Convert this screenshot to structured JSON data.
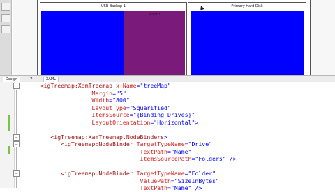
{
  "designer": {
    "treemap_panels": [
      {
        "title": "USB Backup 1",
        "tiles": [
          {
            "label": "",
            "color": "#0000ff"
          },
          {
            "label": "Sprint 1",
            "color": "#7a1a7a"
          }
        ]
      },
      {
        "title": "Primary Hard Disk",
        "tiles": [
          {
            "label": "",
            "color": "#0000ff"
          }
        ]
      }
    ]
  },
  "tabs": {
    "design": "Design",
    "swap": "⇅",
    "xaml": "XAML"
  },
  "editor": {
    "lines": [
      {
        "indent": 6,
        "parts": [
          [
            "tag",
            "<igTreemap:XamTreemap "
          ],
          [
            "attr",
            "x:Name"
          ],
          [
            "pun",
            "=\""
          ],
          [
            "val",
            "treeMap"
          ],
          [
            "pun",
            "\""
          ]
        ]
      },
      {
        "indent": 21,
        "parts": [
          [
            "attr",
            "Margin"
          ],
          [
            "pun",
            "=\""
          ],
          [
            "val",
            "5"
          ],
          [
            "pun",
            "\""
          ]
        ]
      },
      {
        "indent": 21,
        "parts": [
          [
            "attr",
            "Width"
          ],
          [
            "pun",
            "=\""
          ],
          [
            "val",
            "800"
          ],
          [
            "pun",
            "\""
          ]
        ]
      },
      {
        "indent": 21,
        "parts": [
          [
            "attr",
            "LayoutType"
          ],
          [
            "pun",
            "=\""
          ],
          [
            "val",
            "Squarified"
          ],
          [
            "pun",
            "\""
          ]
        ]
      },
      {
        "indent": 21,
        "parts": [
          [
            "attr",
            "ItemsSource"
          ],
          [
            "pun",
            "=\""
          ],
          [
            "val",
            "{Binding Drives}"
          ],
          [
            "pun",
            "\""
          ]
        ]
      },
      {
        "indent": 21,
        "parts": [
          [
            "attr",
            "LayoutOrientation"
          ],
          [
            "pun",
            "=\""
          ],
          [
            "val",
            "Horizontal"
          ],
          [
            "pun",
            "\">"
          ]
        ]
      },
      {
        "indent": 0,
        "parts": []
      },
      {
        "indent": 9,
        "parts": [
          [
            "tag",
            "<igTreemap:XamTreemap.NodeBinders"
          ],
          [
            "pun",
            ">"
          ]
        ]
      },
      {
        "indent": 12,
        "parts": [
          [
            "tag",
            "<igTreemap:NodeBinder "
          ],
          [
            "attr",
            "TargetTypeName"
          ],
          [
            "pun",
            "=\""
          ],
          [
            "val",
            "Drive"
          ],
          [
            "pun",
            "\""
          ]
        ]
      },
      {
        "indent": 35,
        "parts": [
          [
            "attr",
            "TextPath"
          ],
          [
            "pun",
            "=\""
          ],
          [
            "val",
            "Name"
          ],
          [
            "pun",
            "\""
          ]
        ]
      },
      {
        "indent": 35,
        "parts": [
          [
            "attr",
            "ItemsSourcePath"
          ],
          [
            "pun",
            "=\""
          ],
          [
            "val",
            "Folders"
          ],
          [
            "pun",
            "\" />"
          ]
        ]
      },
      {
        "indent": 0,
        "parts": []
      },
      {
        "indent": 12,
        "parts": [
          [
            "tag",
            "<igTreemap:NodeBinder "
          ],
          [
            "attr",
            "TargetTypeName"
          ],
          [
            "pun",
            "=\""
          ],
          [
            "val",
            "Folder"
          ],
          [
            "pun",
            "\""
          ]
        ]
      },
      {
        "indent": 35,
        "parts": [
          [
            "attr",
            "ValuePath"
          ],
          [
            "pun",
            "=\""
          ],
          [
            "val",
            "SizeInBytes"
          ],
          [
            "pun",
            "\""
          ]
        ]
      },
      {
        "indent": 35,
        "parts": [
          [
            "attr",
            "TextPath"
          ],
          [
            "pun",
            "=\""
          ],
          [
            "val",
            "Name"
          ],
          [
            "pun",
            "\" />"
          ]
        ]
      }
    ]
  },
  "colors": {
    "tag": "#a31515",
    "attr": "#d02020",
    "value": "#0000ff",
    "tile_blue": "#0000ff",
    "tile_purple": "#7a1a7a"
  },
  "icons": [
    "fold-minus-icon",
    "mouse-cursor-icon",
    "swap-panes-icon"
  ]
}
